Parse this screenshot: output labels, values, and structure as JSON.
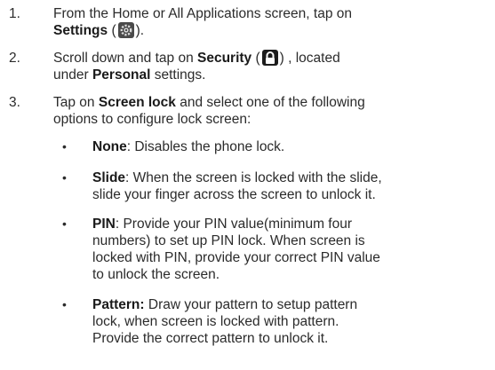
{
  "steps": [
    {
      "number": "1.",
      "pre": "From the Home or All Applications screen, tap on",
      "bold": "Settings",
      "open": " (",
      "close": ")."
    },
    {
      "number": "2.",
      "pre": "Scroll down and tap on ",
      "bold": "Security",
      "open": " (",
      "close": ") , located",
      "line2_pre": "under ",
      "line2_bold": "Personal",
      "line2_post": " settings."
    },
    {
      "number": "3.",
      "pre": "Tap on ",
      "bold": "Screen lock",
      "post": " and select one of the following",
      "line2": "options to configure lock screen:"
    }
  ],
  "options": [
    {
      "bullet": "•",
      "term": "None",
      "lines": [
        ": Disables the phone lock."
      ]
    },
    {
      "bullet": "•",
      "term": "Slide",
      "lines": [
        ": When the screen is locked with the slide,",
        "slide your finger across the screen to unlock it."
      ]
    },
    {
      "bullet": "•",
      "term": "PIN",
      "lines": [
        ": Provide your PIN value(minimum four",
        "numbers) to set up PIN lock. When screen is",
        "locked with PIN, provide your correct PIN value",
        "to unlock the screen."
      ]
    },
    {
      "bullet": "•",
      "term": "Pattern:",
      "lines": [
        " Draw your pattern to setup pattern",
        "lock, when screen is locked with pattern.",
        "Provide the correct pattern to unlock it."
      ]
    }
  ],
  "icons": {
    "settings": "settings-gear-icon",
    "security": "lock-icon"
  }
}
